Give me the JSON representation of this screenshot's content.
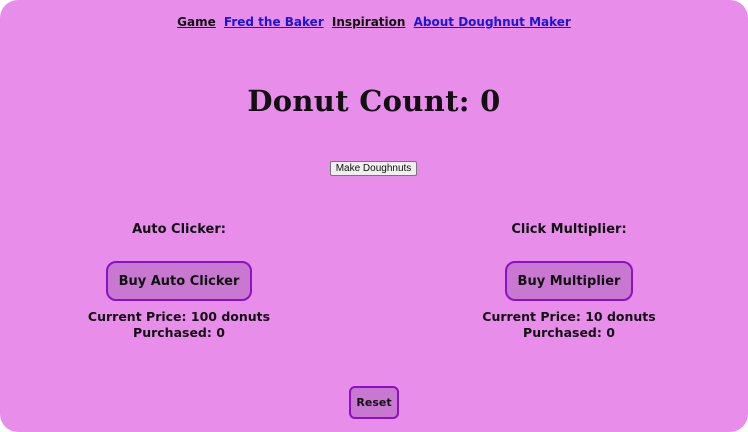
{
  "nav": {
    "links": [
      {
        "label": "Game"
      },
      {
        "label": "Fred the Baker"
      },
      {
        "label": "Inspiration"
      },
      {
        "label": "About Doughnut Maker"
      }
    ]
  },
  "main": {
    "title": "Donut Count: 0",
    "make_button_label": "Make Doughnuts"
  },
  "auto_clicker": {
    "heading": "Auto Clicker:",
    "button_label": "Buy Auto Clicker",
    "price_text": "Current Price: 100 donuts",
    "purchased_text": "Purchased: 0"
  },
  "multiplier": {
    "heading": "Click Multiplier:",
    "button_label": "Buy Multiplier",
    "price_text": "Current Price: 10 donuts",
    "purchased_text": "Purchased: 0"
  },
  "reset_label": "Reset",
  "colors": {
    "background": "#e98deb",
    "button_fill": "#c878d0",
    "button_border": "#8a11c4",
    "link_blue": "#1b16d6"
  }
}
